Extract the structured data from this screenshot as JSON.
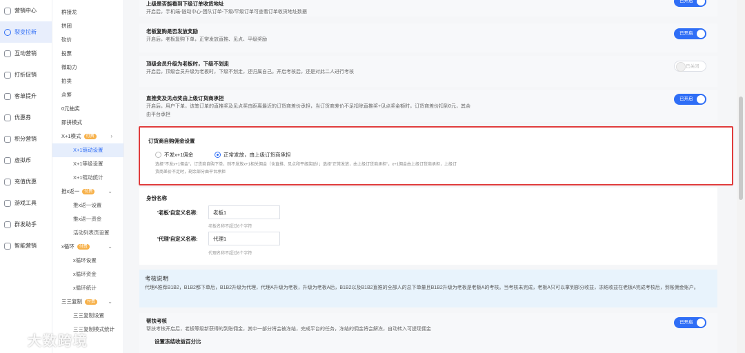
{
  "nav1": [
    {
      "label": "营销中心",
      "icon": "megaphone-icon"
    },
    {
      "label": "裂变拉新",
      "icon": "fission-icon",
      "active": true
    },
    {
      "label": "互动营销",
      "icon": "interact-icon"
    },
    {
      "label": "打折促销",
      "icon": "discount-icon"
    },
    {
      "label": "客单提升",
      "icon": "order-icon"
    },
    {
      "label": "优惠券",
      "icon": "coupon-icon"
    },
    {
      "label": "积分营销",
      "icon": "points-icon"
    },
    {
      "label": "虚拟币",
      "icon": "coin-icon"
    },
    {
      "label": "充值优惠",
      "icon": "recharge-icon"
    },
    {
      "label": "游戏工具",
      "icon": "game-icon"
    },
    {
      "label": "群发助手",
      "icon": "broadcast-icon"
    },
    {
      "label": "智能营销",
      "icon": "smart-icon"
    }
  ],
  "nav2": [
    {
      "label": "群接龙"
    },
    {
      "label": "拼团"
    },
    {
      "label": "砍价"
    },
    {
      "label": "投票"
    },
    {
      "label": "微助力"
    },
    {
      "label": "拍卖"
    },
    {
      "label": "众筹"
    },
    {
      "label": "0元抽奖"
    },
    {
      "label": "即拼模式"
    },
    {
      "label": "X+1模式",
      "badge": "付费",
      "chev": "›"
    },
    {
      "label": "X+1链动设置",
      "sub": true,
      "sel": true
    },
    {
      "label": "X+1等级设置",
      "sub": true
    },
    {
      "label": "X+1链动统计",
      "sub": true
    },
    {
      "label": "推x返一",
      "badge": "付费",
      "chev": "⌄"
    },
    {
      "label": "推x返一设置",
      "sub": true
    },
    {
      "label": "推x返一资金",
      "sub": true
    },
    {
      "label": "活动列表页设置",
      "sub": true
    },
    {
      "label": "x循环",
      "badge": "付费",
      "chev": "⌄"
    },
    {
      "label": "x循环设置",
      "sub": true
    },
    {
      "label": "x循环资金",
      "sub": true
    },
    {
      "label": "x循环统计",
      "sub": true
    },
    {
      "label": "三三复制",
      "badge": "付费",
      "chev": "⌄"
    },
    {
      "label": "三三复制设置",
      "sub": true
    },
    {
      "label": "三三复制模式统计",
      "sub": true
    }
  ],
  "rows": {
    "r0": {
      "title": "上级是否能看到下级订单收货地址",
      "desc": "开启后，手机端-链动中心-团队订单-下级/平级订单可查看订单收货地址数据",
      "toggle": "已开启"
    },
    "r1": {
      "title": "老板复购是否发放奖励",
      "desc": "开启后，老板复购下单，正常发放直推、见点、平级奖励",
      "toggle": "已开启"
    },
    "r2": {
      "title": "顶级会员升级为老板时，下级不划走",
      "desc": "开启后，顶级会员升级为老板时，下级不划走，还归属自己。开启考核后，还是对此二人进行考核",
      "toggle": "已关闭"
    },
    "r3": {
      "title": "直推奖及见点奖由上级订货商承担",
      "desc": "开启后，用户下单，该笔订单的直推奖及见点奖由距离最近的订货商差价承担，当订货商差价不足扣除直推奖+见点奖金额时，订货商差价扣到0元，其余由平台承担",
      "toggle": "已开启"
    }
  },
  "commission": {
    "title": "订货商自购佣金设置",
    "option_a": "不发x+1佣金",
    "option_b": "正常发放，由上级订货商承担",
    "desc": "选择\"不发x+1佣金\"，订货商自购下单，则不发放x+1相关佣金（含直推、见点和平级奖励）；选择\"正常发放，由上级订货商承担\"，x+1佣金由上级订货商承担，上级订货商差价不足时，剩余部分由平台承担"
  },
  "identity": {
    "title": "身份名称",
    "boss_label": "'老板'自定义名称:",
    "boss_value": "老板1",
    "boss_hint": "老板名称不超过6个字符",
    "agent_label": "'代理'自定义名称:",
    "agent_value": "代理1",
    "agent_hint": "代理名称不超过6个字符"
  },
  "assessment": {
    "title": "考核说明",
    "text": "代理A推荐B1B2，B1B2都下单后，B1B2升级为代理，代理A升级为老板，升级为老板A后，B1B2以及B1B2直推的全部人的总下单量且B1B2升级为老板是老板A的考核。当考核未完成，老板A只可以拿到部分收益，冻结收益在老板A完成考核后，到账佣金账户。"
  },
  "help": {
    "title": "帮扶考核",
    "desc": "帮扶考核开启后，老板等级新获得的到账佣金，其中一部分将会被冻结，完成平台的任务，冻结的佣金将会解冻，自动转入可提现佣金",
    "toggle": "已开启",
    "sub_title": "设置冻结收益百分比"
  },
  "watermark": "大数跨境",
  "colors": {
    "primary": "#2f6ef6",
    "highlight_border": "#e03c3c",
    "info_bg": "#e8f3fc"
  }
}
